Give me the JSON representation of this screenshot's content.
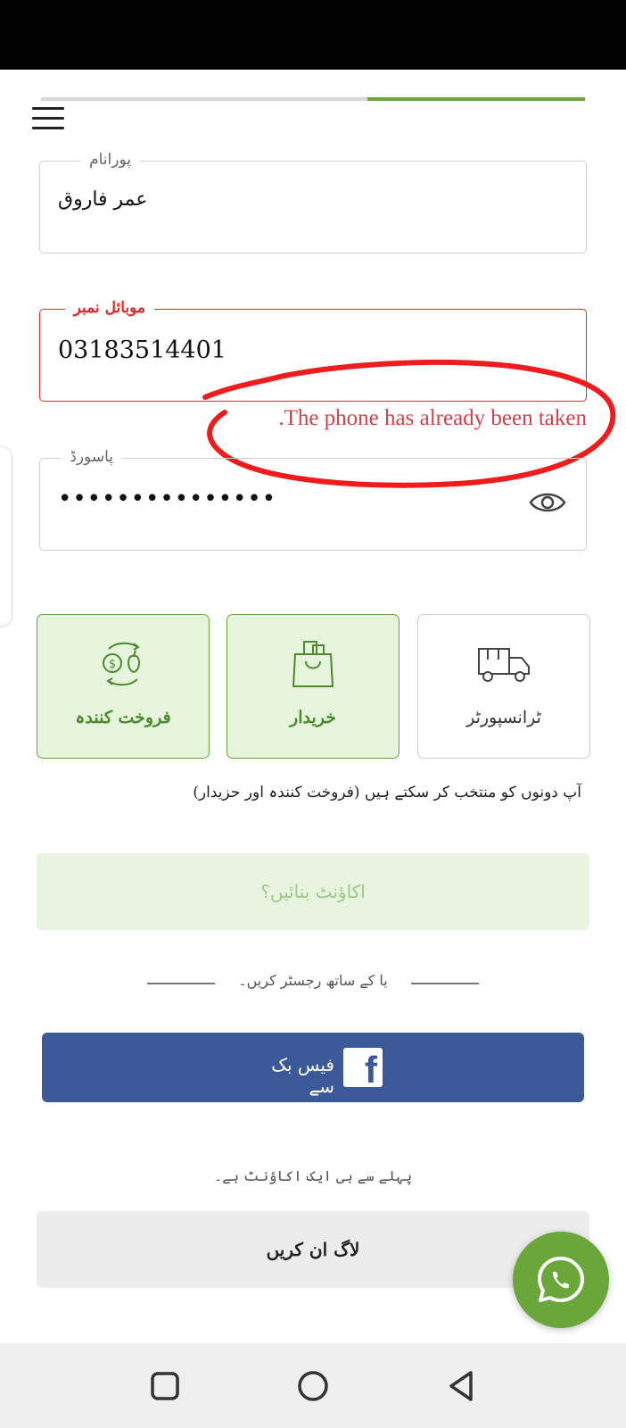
{
  "form": {
    "progress_fraction": 0.4,
    "name": {
      "label": "پورانام",
      "value": "عمر فاروق"
    },
    "mobile": {
      "label": "موبائل نمبر",
      "value": "03183514401",
      "error": ".The phone has already been taken"
    },
    "password": {
      "label": "پاسورڈ",
      "value": "•••••••••••••••"
    }
  },
  "roles": [
    {
      "label": "ٹرانسپورٹر",
      "icon": "truck-icon",
      "selected": false
    },
    {
      "label": "خریدار",
      "icon": "shopping-bag-icon",
      "selected": true
    },
    {
      "label": "فروخت کنندہ",
      "icon": "money-exchange-icon",
      "selected": true
    }
  ],
  "roles_hint": "آپ دونوں کو منتخب کر سکتے ہیں (فروخت کنندہ اور حزیدار)",
  "create_account_label": "اکاؤنٹ بنائیں؟",
  "or_register_with": "یا کے ساتھ رجسٹر کریں۔",
  "facebook_label": "فیس بک سے",
  "already_have_account": "پہلے سے ہی ایک اکاؤنٹ ہے۔",
  "login_label": "لاگ ان کریں",
  "colors": {
    "brand_green": "#6aa63a",
    "error_red": "#e02a2a",
    "facebook_blue": "#3b5998"
  }
}
